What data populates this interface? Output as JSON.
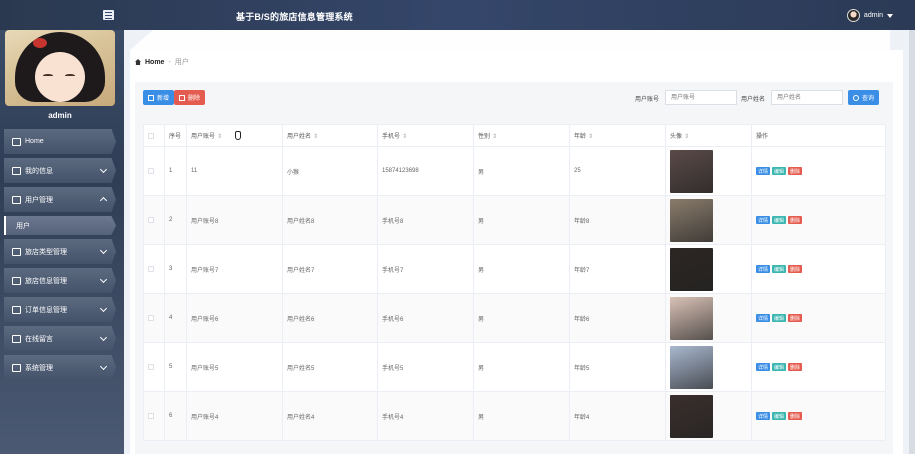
{
  "header": {
    "title": "基于B/S的旅店信息管理系统",
    "username": "admin"
  },
  "sidebar": {
    "username": "admin",
    "items": [
      {
        "label": "Home",
        "icon": "home-icon"
      },
      {
        "label": "我的信息",
        "icon": "profile-icon"
      },
      {
        "label": "用户管理",
        "icon": "users-icon",
        "expanded": true
      },
      {
        "label": "用户",
        "sub": true
      },
      {
        "label": "旅店类型管理",
        "icon": "chat-icon"
      },
      {
        "label": "旅店信息管理",
        "icon": "hotel-icon"
      },
      {
        "label": "订单信息管理",
        "icon": "flag-icon"
      },
      {
        "label": "在线留言",
        "icon": "list-icon"
      },
      {
        "label": "系统管理",
        "icon": "settings-icon"
      }
    ]
  },
  "breadcrumb": {
    "home": "Home",
    "sep": "-",
    "current": "用户"
  },
  "toolbar": {
    "add_label": "新增",
    "delete_label": "删除",
    "account_label": "用户账号",
    "account_placeholder": "用户账号",
    "name_label": "用户姓名",
    "name_placeholder": "用户姓名",
    "search_label": "查询"
  },
  "table": {
    "headers": [
      "序号",
      "用户账号",
      "用户姓名",
      "手机号",
      "性别",
      "年龄",
      "头像",
      "操作"
    ],
    "rows": [
      {
        "no": "1",
        "account": "11",
        "name": "小猴",
        "phone": "15874123698",
        "gender": "男",
        "age": "25",
        "avatar": "#5a4a48"
      },
      {
        "no": "2",
        "account": "用户账号8",
        "name": "用户姓名8",
        "phone": "手机号8",
        "gender": "男",
        "age": "年龄8",
        "avatar": "#8a7c6c"
      },
      {
        "no": "3",
        "account": "用户账号7",
        "name": "用户姓名7",
        "phone": "手机号7",
        "gender": "男",
        "age": "年龄7",
        "avatar": "#2c2623"
      },
      {
        "no": "4",
        "account": "用户账号6",
        "name": "用户姓名6",
        "phone": "手机号6",
        "gender": "男",
        "age": "年龄6",
        "avatar": "#d9c2b6"
      },
      {
        "no": "5",
        "account": "用户账号5",
        "name": "用户姓名5",
        "phone": "手机号5",
        "gender": "男",
        "age": "年龄5",
        "avatar": "#a9b8cf"
      },
      {
        "no": "6",
        "account": "用户账号4",
        "name": "用户姓名4",
        "phone": "手机号4",
        "gender": "男",
        "age": "年龄4",
        "avatar": "#3a2f2c"
      }
    ],
    "ops": {
      "detail": "详情",
      "edit": "编辑",
      "delete": "删除"
    }
  },
  "colors": {
    "primary": "#3a8ee6",
    "danger": "#e45c4f",
    "teal": "#3bb6b0",
    "header": "#34466a"
  }
}
